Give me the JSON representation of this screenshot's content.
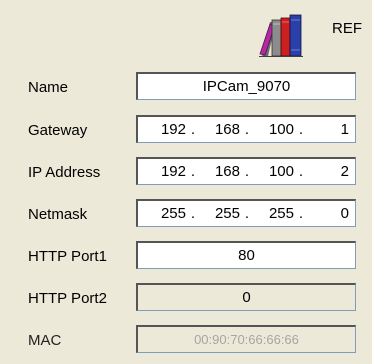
{
  "header": {
    "icon": "books-icon",
    "ref_label": "REF"
  },
  "fields": {
    "name": {
      "label": "Name",
      "value": "IPCam_9070"
    },
    "gateway": {
      "label": "Gateway",
      "octets": [
        "192",
        "168",
        "100",
        "1"
      ]
    },
    "ip_address": {
      "label": "IP Address",
      "octets": [
        "192",
        "168",
        "100",
        "2"
      ]
    },
    "netmask": {
      "label": "Netmask",
      "octets": [
        "255",
        "255",
        "255",
        "0"
      ]
    },
    "http_port1": {
      "label": "HTTP Port1",
      "value": "80"
    },
    "http_port2": {
      "label": "HTTP Port2",
      "value": "0"
    },
    "mac": {
      "label": "MAC",
      "value": "00:90:70:66:66:66"
    }
  },
  "colors": {
    "background": "#ece9d8",
    "book_red": "#cc1f1f",
    "book_blue": "#2a3fa8",
    "book_magenta": "#b02aa0"
  }
}
